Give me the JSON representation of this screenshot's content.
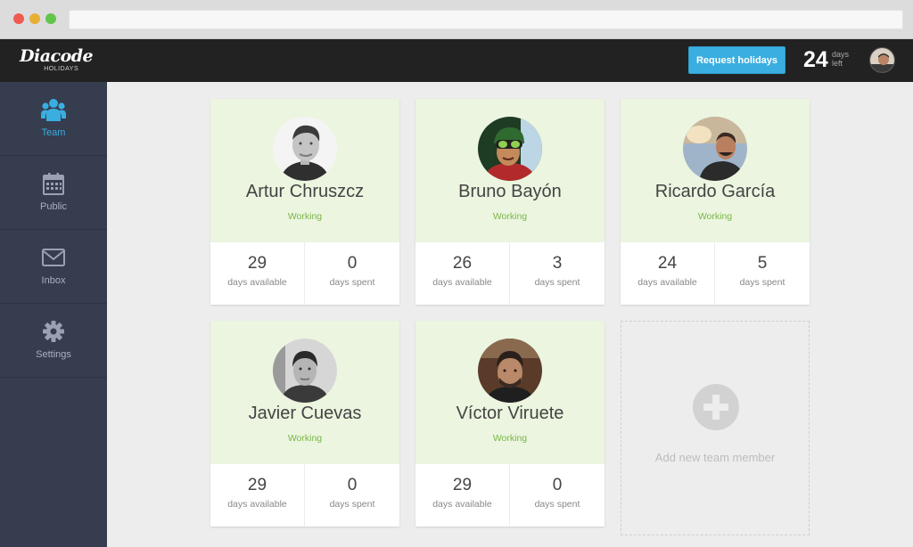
{
  "app": {
    "logo_main": "Diacode",
    "logo_sub": "HOLIDAYS"
  },
  "header": {
    "request_button": "Request holidays",
    "days_left_value": "24",
    "days_left_label_1": "days",
    "days_left_label_2": "left"
  },
  "sidebar": {
    "items": [
      {
        "label": "Team",
        "icon": "team-icon",
        "active": true
      },
      {
        "label": "Public",
        "icon": "calendar-icon",
        "active": false
      },
      {
        "label": "Inbox",
        "icon": "envelope-icon",
        "active": false
      },
      {
        "label": "Settings",
        "icon": "gear-icon",
        "active": false
      }
    ]
  },
  "members": [
    {
      "name": "Artur Chruszcz",
      "status": "Working",
      "days_available": "29",
      "days_available_label": "days available",
      "days_spent": "0",
      "days_spent_label": "days spent"
    },
    {
      "name": "Bruno Bayón",
      "status": "Working",
      "days_available": "26",
      "days_available_label": "days available",
      "days_spent": "3",
      "days_spent_label": "days spent"
    },
    {
      "name": "Ricardo García",
      "status": "Working",
      "days_available": "24",
      "days_available_label": "days available",
      "days_spent": "5",
      "days_spent_label": "days spent"
    },
    {
      "name": "Javier Cuevas",
      "status": "Working",
      "days_available": "29",
      "days_available_label": "days available",
      "days_spent": "0",
      "days_spent_label": "days spent"
    },
    {
      "name": "Víctor Viruete",
      "status": "Working",
      "days_available": "29",
      "days_available_label": "days available",
      "days_spent": "0",
      "days_spent_label": "days spent"
    }
  ],
  "add_member": {
    "label": "Add new team member"
  },
  "colors": {
    "accent": "#3aaee0",
    "status_working": "#7ab648",
    "card_top": "#ebf5df",
    "sidebar": "#363d4f",
    "topbar": "#222222"
  }
}
